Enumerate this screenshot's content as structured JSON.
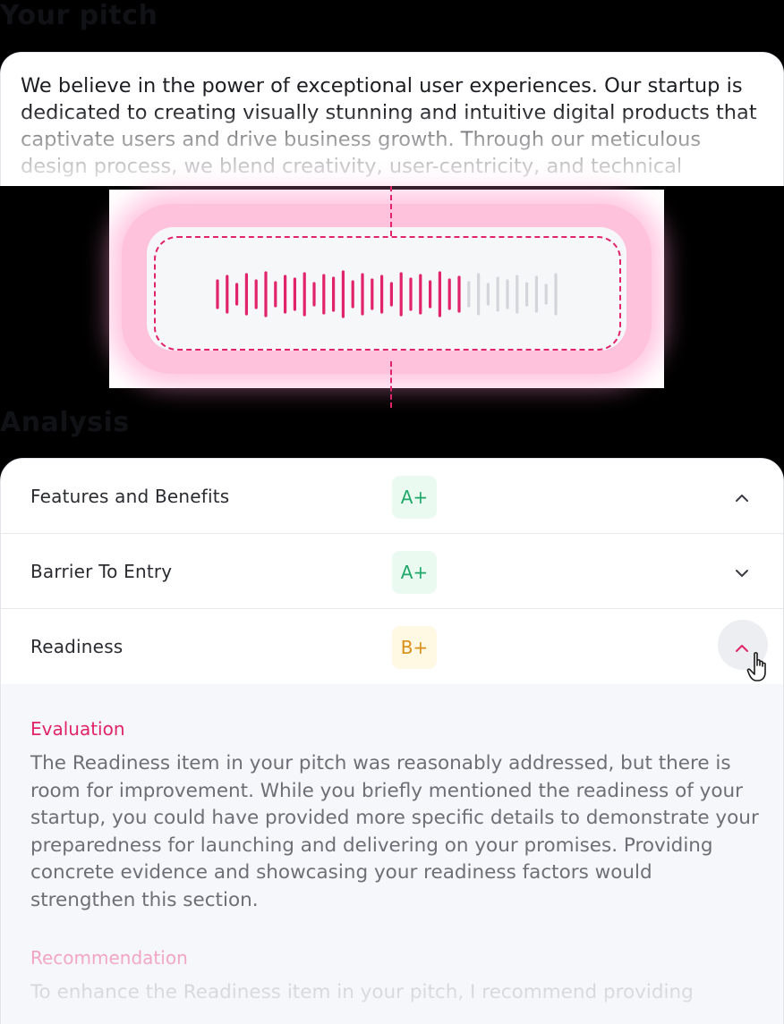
{
  "headings": {
    "your_pitch": "Your pitch",
    "analysis": "Analysis"
  },
  "pitch": {
    "text": "We believe in the power of exceptional user experiences. Our startup is dedicated to creating visually stunning and intuitive digital products that captivate users and drive business growth. Through our meticulous design process, we blend creativity, user-centricity, and technical"
  },
  "recording": {
    "progress": 0.72,
    "bar_count": 36,
    "active_color": "#e0236a",
    "inactive_color": "#d3d5da"
  },
  "analysis": {
    "items": [
      {
        "label": "Features and Benefits",
        "grade": "A+",
        "grade_tone": "green",
        "chevron": "chevron-up-icon"
      },
      {
        "label": "Barrier To Entry",
        "grade": "A+",
        "grade_tone": "green",
        "chevron": "chevron-down-icon"
      },
      {
        "label": "Readiness",
        "grade": "B+",
        "grade_tone": "amber",
        "chevron": "chevron-up-icon",
        "expanded": true
      }
    ],
    "details": {
      "evaluation_title": "Evaluation",
      "evaluation_body": "The Readiness item in your pitch was reasonably addressed, but there is room for improvement. While you briefly mentioned the readiness of your startup, you could have provided more specific details to demonstrate your preparedness for launching and delivering on your promises. Providing concrete evidence and showcasing your readiness factors would strengthen this section.",
      "recommendation_title": "Recommendation",
      "recommendation_body": "To enhance the Readiness item in your pitch, I recommend providing"
    }
  },
  "colors": {
    "accent": "#e0236a",
    "grade_green": "#20a86a",
    "grade_amber": "#d98f1a"
  }
}
